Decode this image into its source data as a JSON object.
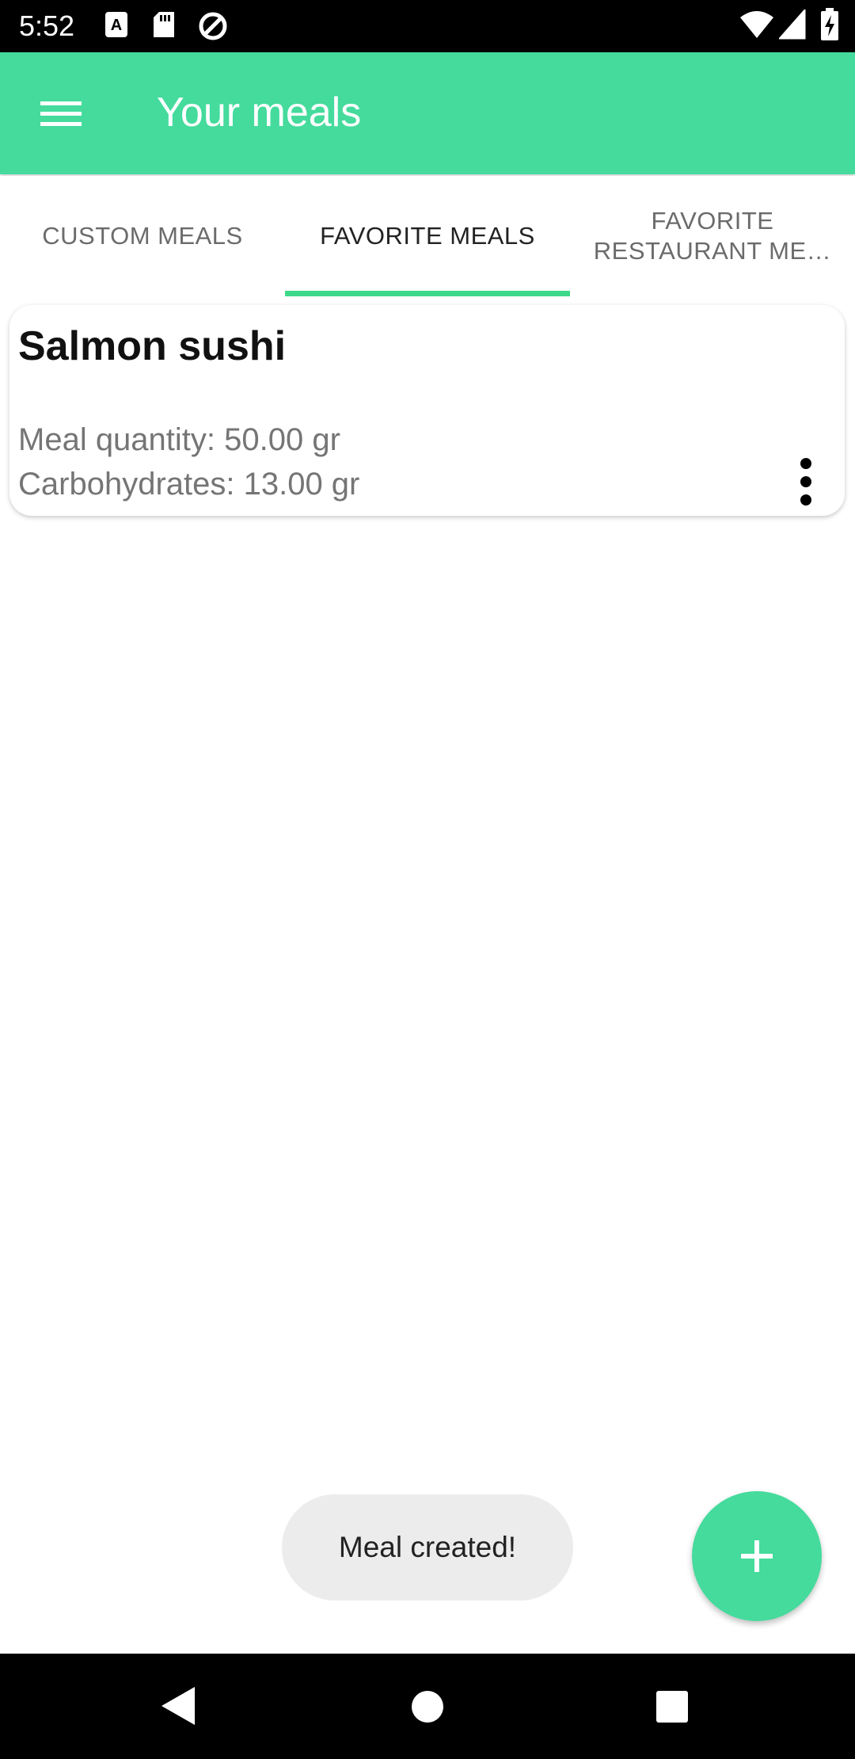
{
  "status_bar": {
    "time": "5:52",
    "left_icons": [
      "accessibility-icon",
      "sd-card-icon",
      "data-saver-icon"
    ],
    "right_icons": [
      "wifi-icon",
      "signal-icon",
      "battery-charging-icon"
    ]
  },
  "app_bar": {
    "title": "Your meals",
    "menu_icon": "hamburger-menu-icon",
    "color": "#44DB9C"
  },
  "tabs": [
    {
      "label": "CUSTOM MEALS",
      "active": false
    },
    {
      "label": "FAVORITE MEALS",
      "active": true
    },
    {
      "label_line1": "FAVORITE",
      "label_line2": "RESTAURANT ME…",
      "active": false
    }
  ],
  "meals": [
    {
      "name": "Salmon sushi",
      "quantity": "Meal quantity: 50.00 gr",
      "carbs": "Carbohydrates: 13.00 gr"
    }
  ],
  "toast": {
    "text": "Meal created!"
  },
  "fab": {
    "icon": "plus-icon",
    "color": "#44DB9C"
  },
  "nav_bar": {
    "icons": [
      "back-icon",
      "home-icon",
      "recents-icon"
    ]
  },
  "colors": {
    "accent": "#44DB9C",
    "tab_indicator": "#3DD98A"
  }
}
